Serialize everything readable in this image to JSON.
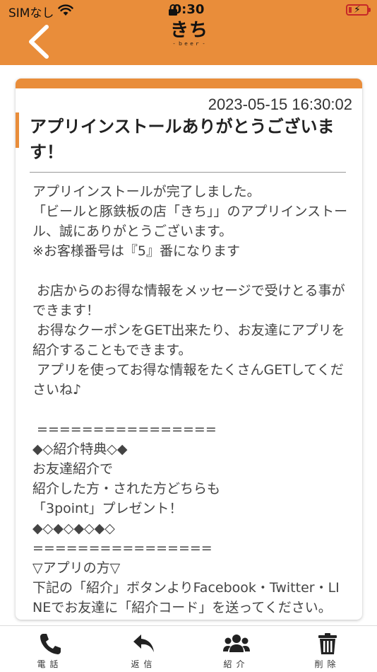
{
  "status_bar": {
    "carrier": "SIMなし",
    "time": "0:30"
  },
  "header": {
    "logo_text": "きち",
    "logo_sub": "- ｂｅｅｒ -"
  },
  "message": {
    "date": "2023-05-15 16:30:02",
    "title": "アプリインストールありがとうございます！",
    "body": "アプリインストールが完了しました。\n「ビールと豚鉄板の店「きち」」のアプリインストール、誠にありがとうございます。\n※お客様番号は『5』番になります\n\n お店からのお得な情報をメッセージで受けとる事ができます！\n お得なクーポンをGET出来たり、お友達にアプリを紹介することもできます。\n アプリを使ってお得な情報をたくさんGETしてくださいね♪\n\n ================\n◆◇紹介特典◇◆\nお友達紹介で\n紹介した方・された方どちらも\n「3point」プレゼント！\n◆◇◆◇◆◇◆◇\n================\n▽アプリの方▽\n下記の「紹介」ボタンよりFacebook・Twitter・LINEでお友達に「紹介コード」を送ってください。"
  },
  "tab_bar": {
    "phone": "電話",
    "reply": "返信",
    "share": "紹介",
    "delete": "削除"
  }
}
